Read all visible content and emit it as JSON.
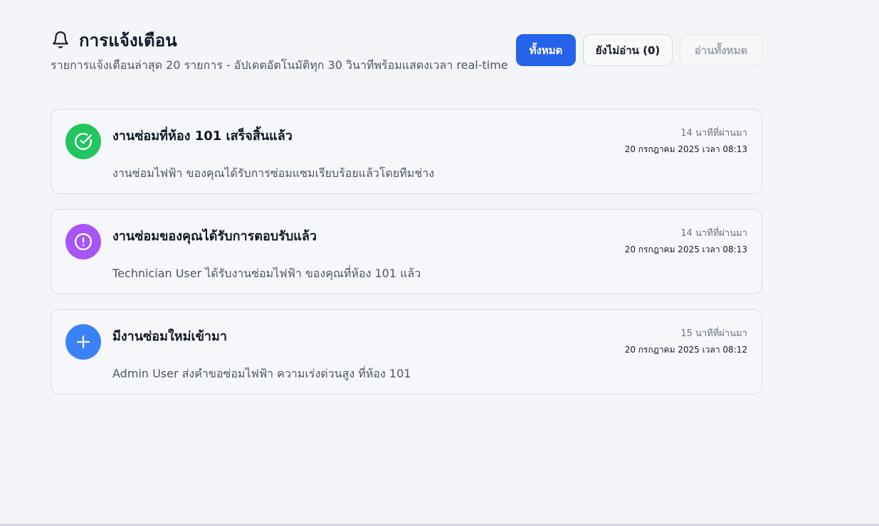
{
  "header": {
    "icon": "bell-icon",
    "title": "การแจ้งเตือน",
    "subtitle": "รายการแจ้งเตือนล่าสุด 20 รายการ - อัปเดตอัตโนมัติทุก 30 วินาทีพร้อมแสดงเวลา real-time"
  },
  "filters": {
    "all": "ทั้งหมด",
    "unread": "ยังไม่อ่าน (0)",
    "read_all": "อ่านทั้งหมด"
  },
  "colors": {
    "primary": "#2563eb",
    "success": "#22c55e",
    "warning": "#a855f7",
    "info": "#3b82f6"
  },
  "notifications": [
    {
      "icon": "check-circle-icon",
      "icon_color": "#22c55e",
      "title": "งานซ่อมที่ห้อง 101 เสร็จสิ้นแล้ว",
      "message": "งานซ่อมไฟฟ้า ของคุณได้รับการซ่อมแซมเรียบร้อยแล้วโดยทีมช่าง",
      "time_ago": "14  นาทีที่ผ่านมา",
      "timestamp": "20 กรกฎาคม 2025 เวลา 08:13"
    },
    {
      "icon": "alert-circle-icon",
      "icon_color": "#a855f7",
      "title": "งานซ่อมของคุณได้รับการตอบรับแล้ว",
      "message": "Technician User ได้รับงานซ่อมไฟฟ้า ของคุณที่ห้อง 101 แล้ว",
      "time_ago": "14  นาทีที่ผ่านมา",
      "timestamp": "20 กรกฎาคม 2025 เวลา 08:13"
    },
    {
      "icon": "plus-icon",
      "icon_color": "#3b82f6",
      "title": "มีงานซ่อมใหม่เข้ามา",
      "message": "Admin User ส่งคำขอซ่อมไฟฟ้า ความเร่งด่วนสูง ที่ห้อง 101",
      "time_ago": "15  นาทีที่ผ่านมา",
      "timestamp": "20 กรกฎาคม 2025 เวลา 08:12"
    }
  ]
}
